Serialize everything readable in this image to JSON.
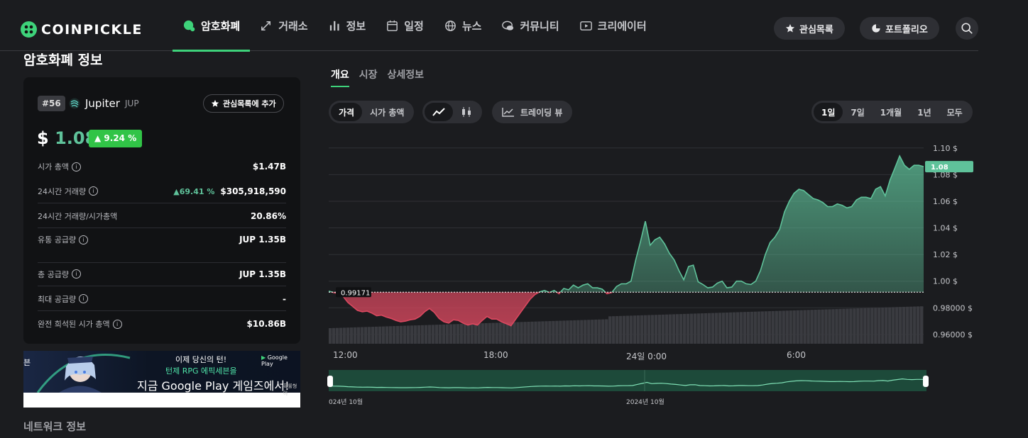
{
  "header": {
    "logo_text": "COINPICKLE",
    "nav": [
      {
        "label": "암호화폐",
        "icon": "coin-bubble-icon",
        "active": true
      },
      {
        "label": "거래소",
        "icon": "exchange-icon"
      },
      {
        "label": "정보",
        "icon": "bar-chart-icon"
      },
      {
        "label": "일정",
        "icon": "calendar-icon"
      },
      {
        "label": "뉴스",
        "icon": "globe-icon"
      },
      {
        "label": "커뮤니티",
        "icon": "chat-icon"
      },
      {
        "label": "크리에이터",
        "icon": "play-icon"
      }
    ],
    "watchlist_label": "관심목록",
    "portfolio_label": "포트폴리오"
  },
  "left": {
    "section_title": "암호화폐 정보",
    "rank": "#56",
    "coin_name": "Jupiter",
    "coin_symbol": "JUP",
    "add_watchlist_label": "관심목록에 추가",
    "price_currency": "$",
    "price_value": "1.08",
    "price_change": "9.24 %",
    "stats": [
      {
        "label": "시가 총액",
        "value": "$1.47B"
      },
      {
        "label": "24시간 거래량",
        "change": "69.41 %",
        "value": "$305,918,590"
      },
      {
        "label": "24시간 거래량/시가총액",
        "value": "20.86%"
      },
      {
        "label": "유통 공급량",
        "value": "JUP 1.35B"
      },
      {
        "label": "총 공급량",
        "value": "JUP 1.35B"
      },
      {
        "label": "최대 공급량",
        "value": "-"
      },
      {
        "label": "완전 희석된 시가 총액",
        "value": "$10.86B"
      }
    ],
    "ad": {
      "line1": "이제 당신의 턴!",
      "line2": "턴제 RPG 에픽세븐을",
      "line3": "지금 Google Play 게임즈에서!",
      "google_play": "Google Play",
      "small": "확률형 아",
      "edge": "븐"
    },
    "network_title": "네트워크 정보"
  },
  "right": {
    "tabs": [
      "개요",
      "시장",
      "상세정보"
    ],
    "price_toggle": [
      "가격",
      "시가 총액"
    ],
    "trading_view_label": "트레이딩 뷰",
    "ranges": [
      "1일",
      "7일",
      "1개월",
      "1년",
      "모두"
    ],
    "x_labels": [
      "12:00",
      "18:00",
      "24일 0:00",
      "6:00"
    ],
    "mini_labels": [
      "024년 10월",
      "2024년 10월"
    ],
    "colors": {
      "up": "#5fc29a",
      "down": "#d9485f",
      "accent": "#3ed27a"
    }
  },
  "chart_data": {
    "type": "area",
    "baseline_label": "0.99171",
    "current_label": "1.08",
    "y_ticks": [
      "1.10 $",
      "1.08 $",
      "1.06 $",
      "1.04 $",
      "1.02 $",
      "1.00 $",
      "0.98000 $",
      "0.96000 $"
    ],
    "ylim": [
      0.953,
      1.11
    ],
    "baseline": 0.99171,
    "x_labels": [
      "12:00",
      "18:00",
      "24일 0:00",
      "6:00"
    ],
    "series": [
      {
        "values": [
          0.9925,
          0.9915,
          0.9905,
          0.9885,
          0.984,
          0.981,
          0.978,
          0.977,
          0.9775,
          0.976,
          0.974,
          0.9745,
          0.973,
          0.972,
          0.9705,
          0.9695,
          0.97,
          0.971,
          0.9715,
          0.9735,
          0.977,
          0.9795,
          0.9765,
          0.972,
          0.9695,
          0.9685,
          0.971,
          0.9705,
          0.9685,
          0.967,
          0.968,
          0.967,
          0.9705,
          0.9735,
          0.9715,
          0.9715,
          0.9695,
          0.968,
          0.9665,
          0.9715,
          0.9765,
          0.9815,
          0.9865,
          0.99,
          0.992,
          0.993,
          0.9915,
          0.993,
          0.9905,
          0.9945,
          0.9935,
          0.997,
          0.995,
          0.997,
          0.998,
          0.995,
          0.995,
          0.994,
          0.9905,
          0.9915,
          0.996,
          0.998,
          0.998,
          1.0,
          1.016,
          1.03,
          1.045,
          1.027,
          1.031,
          1.033,
          1.028,
          1.021,
          1.016,
          1.008,
          1.001,
          1.011,
          1.012,
          0.9995,
          0.9975,
          0.995,
          0.9955,
          0.9985,
          1.0,
          0.995,
          0.9955,
          1.0,
          1.0,
          0.998,
          0.9975,
          1.0,
          1.008,
          1.02,
          1.029,
          1.033,
          1.039,
          1.052,
          1.06,
          1.066,
          1.069,
          1.068,
          1.065,
          1.062,
          1.061,
          1.059,
          1.056,
          1.056,
          1.058,
          1.057,
          1.055,
          1.056,
          1.061,
          1.063,
          1.063,
          1.062,
          1.069,
          1.071,
          1.064,
          1.076,
          1.085,
          1.094,
          1.087,
          1.084,
          1.087,
          1.087,
          1.086
        ]
      }
    ]
  }
}
